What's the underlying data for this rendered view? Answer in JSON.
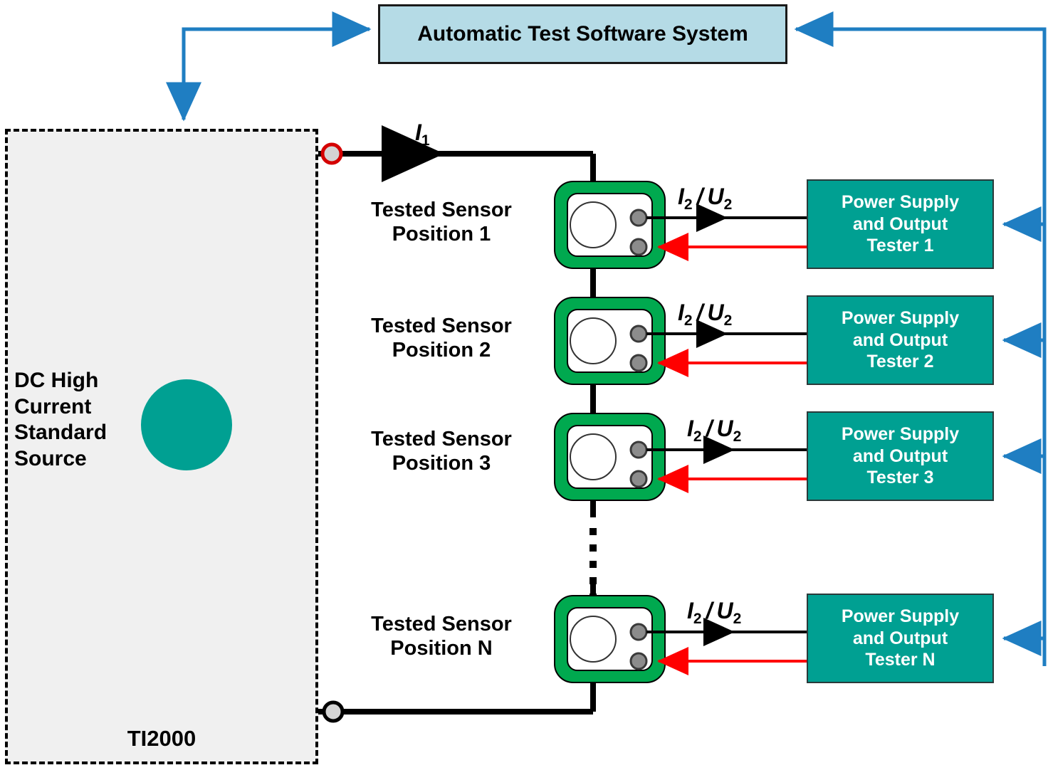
{
  "diagram": {
    "title": "Automatic Test Software System",
    "type": "block-wiring-diagram"
  },
  "software_system": {
    "label": "Automatic Test Software System",
    "fill_color": "#b5dbe6",
    "border_color": "#1a1a1a"
  },
  "source_enclosure": {
    "name": "TI2000",
    "source_label_line1": "DC High",
    "source_label_line2": "Current",
    "source_label_line3": "Standard",
    "source_label_line4": "Source",
    "fill_color": "#f0f0f0",
    "border_style": "dashed",
    "symbol": "current-source-up-arrow",
    "symbol_color": "#00a092"
  },
  "primary_current": {
    "label_text": "I",
    "label_sub": "1",
    "direction": "right"
  },
  "sensors": [
    {
      "line1": "Tested Sensor",
      "line2": "Position 1",
      "frame_color": "#00a94f"
    },
    {
      "line1": "Tested Sensor",
      "line2": "Position 2",
      "frame_color": "#00a94f"
    },
    {
      "line1": "Tested Sensor",
      "line2": "Position 3",
      "frame_color": "#00a94f"
    },
    {
      "line1": "Tested Sensor",
      "line2": "Position N",
      "frame_color": "#00a94f"
    }
  ],
  "secondary_signal": {
    "label_i": "I",
    "label_i_sub": "2",
    "separator": "/",
    "label_u": "U",
    "label_u_sub": "2"
  },
  "testers": [
    {
      "line1": "Power Supply",
      "line2": "and Output",
      "line3": "Tester 1",
      "fill_color": "#00a092"
    },
    {
      "line1": "Power Supply",
      "line2": "and Output",
      "line3": "Tester 2",
      "fill_color": "#00a092"
    },
    {
      "line1": "Power Supply",
      "line2": "and Output",
      "line3": "Tester 3",
      "fill_color": "#00a092"
    },
    {
      "line1": "Power Supply",
      "line2": "and Output",
      "line3": "Tester N",
      "fill_color": "#00a092"
    }
  ],
  "colors": {
    "control_bus": "#1f7ec2",
    "power_wire": "#000000",
    "feedback_wire": "#ff0000",
    "terminal_top_ring": "#d40000",
    "terminal_bottom_ring": "#000000",
    "terminal_fill": "#d4d4d4",
    "sensor_terminal": "#8c8c8c"
  },
  "ellipsis": {
    "dots": 5,
    "meaning": "additional sensor positions"
  }
}
